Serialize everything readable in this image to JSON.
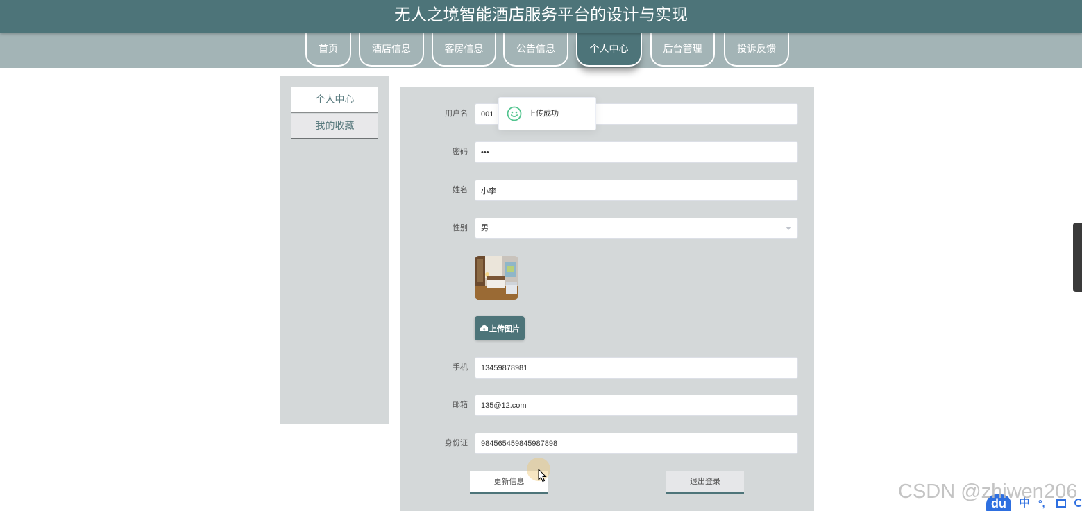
{
  "header": {
    "title": "无人之境智能酒店服务平台的设计与实现"
  },
  "nav": {
    "items": [
      {
        "label": "首页",
        "active": false
      },
      {
        "label": "酒店信息",
        "active": false
      },
      {
        "label": "客房信息",
        "active": false
      },
      {
        "label": "公告信息",
        "active": false
      },
      {
        "label": "个人中心",
        "active": true
      },
      {
        "label": "后台管理",
        "active": false
      },
      {
        "label": "投诉反馈",
        "active": false
      }
    ]
  },
  "sidebar": {
    "items": [
      {
        "label": "个人中心",
        "active": true
      },
      {
        "label": "我的收藏",
        "active": false
      }
    ]
  },
  "form": {
    "username": {
      "label": "用户名",
      "value": "001"
    },
    "password": {
      "label": "密码",
      "value": "•••"
    },
    "name": {
      "label": "姓名",
      "value": "小李"
    },
    "gender": {
      "label": "性别",
      "value": "男"
    },
    "photo": {
      "icon": "room-photo-image"
    },
    "upload_button": {
      "label": "上传图片",
      "icon": "cloud-upload-icon"
    },
    "phone": {
      "label": "手机",
      "value": "13459878981"
    },
    "email": {
      "label": "邮箱",
      "value": "135@12.com"
    },
    "id_card": {
      "label": "身份证",
      "value": "984565459845987898"
    },
    "update_button": {
      "label": "更新信息"
    },
    "logout_button": {
      "label": "退出登录"
    }
  },
  "toast": {
    "message": "上传成功",
    "icon": "smile-icon"
  },
  "watermark": {
    "text": "CSDN @zhiwen206"
  },
  "ime_toolbar": {
    "logo": "du",
    "language": "中",
    "punctuation": "°,"
  },
  "colors": {
    "primary": "#4d7479",
    "nav_background": "#a3b4b6",
    "panel_background": "#d4d8d9",
    "success": "#52c48f",
    "ime_blue": "#2e6fe0"
  }
}
